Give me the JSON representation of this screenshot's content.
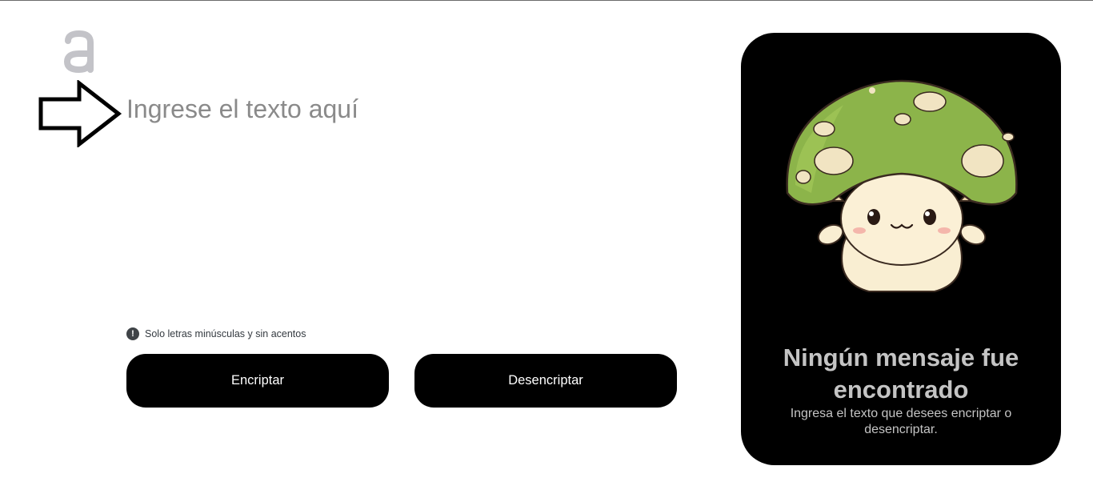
{
  "logo": {
    "icon": "alura-logo-icon",
    "color": "#c3c3c8"
  },
  "arrow": {
    "icon": "arrow-right-outline-icon"
  },
  "editor": {
    "placeholder": "Ingrese el texto aquí",
    "value": ""
  },
  "hint": {
    "icon": "exclamation-circle-icon",
    "icon_glyph": "!",
    "text": "Solo letras minúsculas y sin acentos"
  },
  "buttons": {
    "encrypt_label": "Encriptar",
    "decrypt_label": "Desencriptar"
  },
  "result_panel": {
    "image": "mushroom-character-icon",
    "title": "Ningún mensaje fue encontrado",
    "subtitle": "Ingresa el texto que desees encriptar o desencriptar."
  },
  "colors": {
    "button_bg": "#000000",
    "button_text": "#ffffff",
    "panel_bg": "#000000",
    "panel_text": "#c4c4c4",
    "placeholder": "#8a8a8a"
  }
}
